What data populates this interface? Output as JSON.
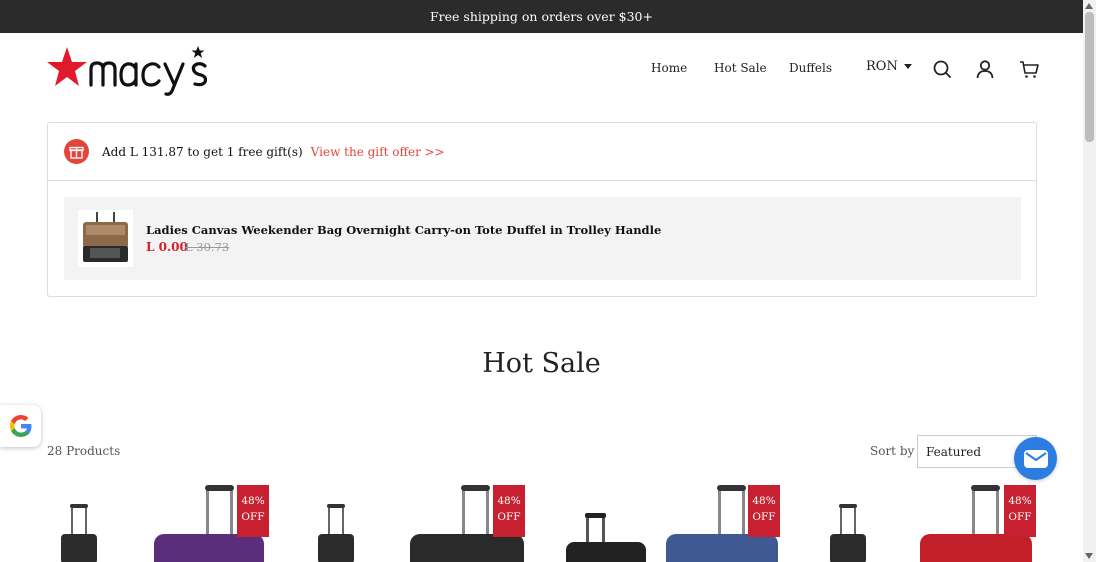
{
  "announcement": "Free shipping on orders over $30+",
  "brand": {
    "name": "macys",
    "star_color": "#e11a2b"
  },
  "nav": {
    "home": "Home",
    "hot_sale": "Hot Sale",
    "duffels": "Duffels",
    "currency": "RON"
  },
  "header_icons": [
    "search-icon",
    "account-icon",
    "cart-icon"
  ],
  "gift": {
    "message": "Add L 131.87 to get 1 free gift(s)",
    "link": "View the gift offer >>",
    "item_title": "Ladies Canvas Weekender Bag Overnight Carry-on Tote Duffel in Trolley Handle",
    "price": "L 0.00",
    "old_price": "L 30.73"
  },
  "section_title": "Hot Sale",
  "listing": {
    "count": "28 Products",
    "sort_label": "Sort by",
    "sort_value": "Featured"
  },
  "products": [
    {
      "badge_pct": "48%",
      "badge_off": "OFF",
      "color": "#5a2e7a"
    },
    {
      "badge_pct": "48%",
      "badge_off": "OFF",
      "color": "#2a2a2a"
    },
    {
      "badge_pct": "48%",
      "badge_off": "OFF",
      "color": "#3f5a93"
    },
    {
      "badge_pct": "48%",
      "badge_off": "OFF",
      "color": "#c21f2a"
    }
  ],
  "colors": {
    "accent": "#e4453a",
    "badge": "#c72131",
    "chat": "#2b7de0"
  }
}
